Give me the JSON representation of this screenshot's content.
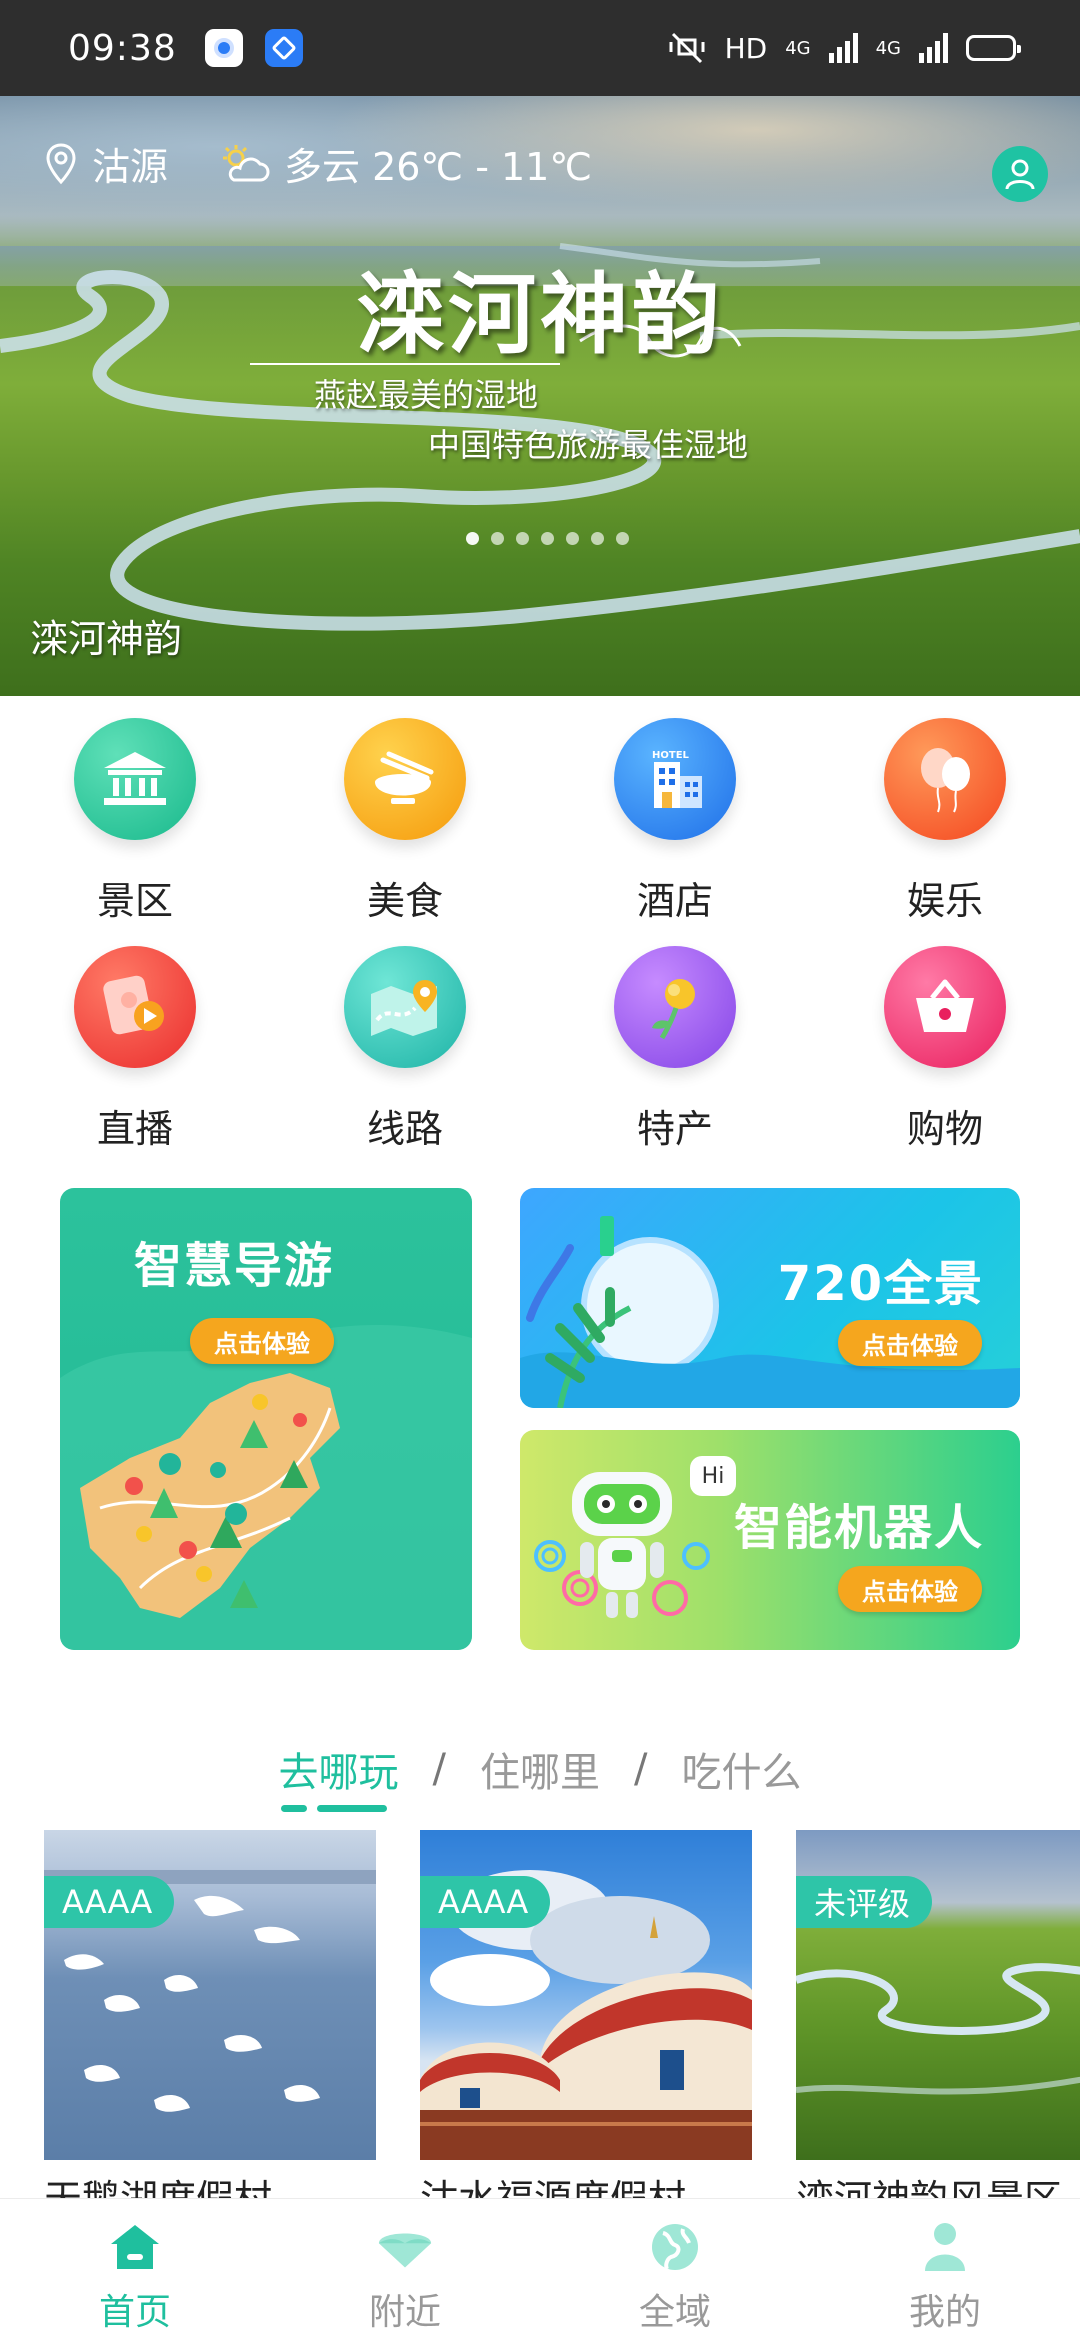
{
  "status_bar": {
    "time": "09:38",
    "network": "HD",
    "signal_1": "4G",
    "signal_2": "4G",
    "battery_level": 1.0
  },
  "banner": {
    "location": "沽源",
    "weather": "多云 26℃ - 11℃",
    "title": "滦河神韵",
    "subtitle_1": "燕赵最美的湿地",
    "subtitle_2": "中国特色旅游最佳湿地",
    "caption": "滦河神韵",
    "slide_count": 7,
    "active_slide": 0
  },
  "categories": [
    {
      "label": "景区",
      "icon": "temple-icon",
      "color": "#26c29a"
    },
    {
      "label": "美食",
      "icon": "food-bowl-icon",
      "color": "#f9a717"
    },
    {
      "label": "酒店",
      "icon": "hotel-icon",
      "color": "#2f8ff5"
    },
    {
      "label": "娱乐",
      "icon": "balloon-icon",
      "color": "#fb5b2f"
    },
    {
      "label": "直播",
      "icon": "live-stream-icon",
      "color": "#f5493f"
    },
    {
      "label": "线路",
      "icon": "route-map-icon",
      "color": "#2ec4b6"
    },
    {
      "label": "特产",
      "icon": "flower-icon",
      "color": "#a05cf0"
    },
    {
      "label": "购物",
      "icon": "shopping-basket-icon",
      "color": "#f23c74"
    }
  ],
  "features": {
    "guide": {
      "title": "智慧导游",
      "button": "点击体验"
    },
    "panorama": {
      "title": "720全景",
      "button": "点击体验"
    },
    "robot": {
      "title": "智能机器人",
      "button": "点击体验",
      "bubble": "Hi"
    }
  },
  "tabs": [
    {
      "label": "去哪玩",
      "active": true
    },
    {
      "label": "住哪里",
      "active": false
    },
    {
      "label": "吃什么",
      "active": false
    }
  ],
  "tab_separator": "/",
  "places": [
    {
      "name": "天鹅湖度假村",
      "badge": "AAAA"
    },
    {
      "name": "沽水福源度假村",
      "badge": "AAAA"
    },
    {
      "name": "滦河神韵风景区",
      "badge": "未评级"
    }
  ],
  "bottom_nav": [
    {
      "label": "首页",
      "icon": "home-icon",
      "active": true
    },
    {
      "label": "附近",
      "icon": "nearby-umbrella-icon",
      "active": false
    },
    {
      "label": "全域",
      "icon": "globe-icon",
      "active": false
    },
    {
      "label": "我的",
      "icon": "profile-icon",
      "active": false
    }
  ],
  "colors": {
    "accent": "#1fbf9e",
    "button_orange": "#f5a61e",
    "inactive_text": "#999999"
  }
}
